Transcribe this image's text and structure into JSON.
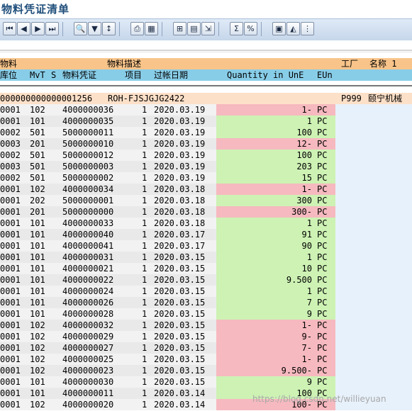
{
  "title": "物料凭证清单",
  "toolbar": {
    "buttons": [
      {
        "name": "first-page",
        "glyph": "⏮"
      },
      {
        "name": "prev",
        "glyph": "◀"
      },
      {
        "name": "next",
        "glyph": "▶"
      },
      {
        "name": "last-page",
        "glyph": "⏭"
      },
      {
        "name": "find",
        "glyph": "🔍"
      },
      {
        "name": "filter",
        "glyph": "▼"
      },
      {
        "name": "sort",
        "glyph": "↕"
      },
      {
        "name": "print",
        "glyph": "⎙"
      },
      {
        "name": "select-layout",
        "glyph": "▦"
      },
      {
        "name": "details",
        "glyph": "⊞"
      },
      {
        "name": "grid",
        "glyph": "▤"
      },
      {
        "name": "export",
        "glyph": "⇲"
      },
      {
        "name": "sum",
        "glyph": "Σ"
      },
      {
        "name": "subtotal",
        "glyph": "%"
      },
      {
        "name": "abc",
        "glyph": "▣"
      },
      {
        "name": "graph",
        "glyph": "◭"
      },
      {
        "name": "views",
        "glyph": "⋮"
      }
    ]
  },
  "header": {
    "row1": {
      "material": "物料",
      "description": "物料描述",
      "plant": "工厂",
      "name": "名称 1"
    },
    "row2": {
      "sloc": "库位",
      "mvt": "MvT",
      "s": "S",
      "doc": "物料凭证",
      "item": "项目",
      "date": "过帐日期",
      "qty": "Quantity in UnE",
      "eun": "EUn"
    }
  },
  "group": {
    "material": "000000000000001256",
    "description": "ROH-FJSJGJG2422",
    "plant": "P999",
    "name": "颐宁机械"
  },
  "rows": [
    {
      "sloc": "0001",
      "mvt": "102",
      "doc": "4000000036",
      "item": "1",
      "date": "2020.03.19",
      "qty": "1-",
      "unit": "PC",
      "neg": true
    },
    {
      "sloc": "0001",
      "mvt": "101",
      "doc": "4000000035",
      "item": "1",
      "date": "2020.03.19",
      "qty": "1",
      "unit": "PC",
      "neg": false
    },
    {
      "sloc": "0002",
      "mvt": "501",
      "doc": "5000000011",
      "item": "1",
      "date": "2020.03.19",
      "qty": "100",
      "unit": "PC",
      "neg": false
    },
    {
      "sloc": "0003",
      "mvt": "201",
      "doc": "5000000010",
      "item": "1",
      "date": "2020.03.19",
      "qty": "12-",
      "unit": "PC",
      "neg": true
    },
    {
      "sloc": "0002",
      "mvt": "501",
      "doc": "5000000012",
      "item": "1",
      "date": "2020.03.19",
      "qty": "100",
      "unit": "PC",
      "neg": false
    },
    {
      "sloc": "0003",
      "mvt": "501",
      "doc": "5000000003",
      "item": "1",
      "date": "2020.03.19",
      "qty": "203",
      "unit": "PC",
      "neg": false
    },
    {
      "sloc": "0002",
      "mvt": "501",
      "doc": "5000000002",
      "item": "1",
      "date": "2020.03.19",
      "qty": "15",
      "unit": "PC",
      "neg": false
    },
    {
      "sloc": "0001",
      "mvt": "102",
      "doc": "4000000034",
      "item": "1",
      "date": "2020.03.18",
      "qty": "1-",
      "unit": "PC",
      "neg": true
    },
    {
      "sloc": "0001",
      "mvt": "202",
      "doc": "5000000001",
      "item": "1",
      "date": "2020.03.18",
      "qty": "300",
      "unit": "PC",
      "neg": false
    },
    {
      "sloc": "0001",
      "mvt": "201",
      "doc": "5000000000",
      "item": "1",
      "date": "2020.03.18",
      "qty": "300-",
      "unit": "PC",
      "neg": true
    },
    {
      "sloc": "0001",
      "mvt": "101",
      "doc": "4000000033",
      "item": "1",
      "date": "2020.03.18",
      "qty": "1",
      "unit": "PC",
      "neg": false
    },
    {
      "sloc": "0001",
      "mvt": "101",
      "doc": "4000000040",
      "item": "1",
      "date": "2020.03.17",
      "qty": "91",
      "unit": "PC",
      "neg": false
    },
    {
      "sloc": "0001",
      "mvt": "101",
      "doc": "4000000041",
      "item": "1",
      "date": "2020.03.17",
      "qty": "90",
      "unit": "PC",
      "neg": false
    },
    {
      "sloc": "0001",
      "mvt": "101",
      "doc": "4000000031",
      "item": "1",
      "date": "2020.03.15",
      "qty": "1",
      "unit": "PC",
      "neg": false
    },
    {
      "sloc": "0001",
      "mvt": "101",
      "doc": "4000000021",
      "item": "1",
      "date": "2020.03.15",
      "qty": "10",
      "unit": "PC",
      "neg": false
    },
    {
      "sloc": "0001",
      "mvt": "101",
      "doc": "4000000022",
      "item": "1",
      "date": "2020.03.15",
      "qty": "9.500",
      "unit": "PC",
      "neg": false
    },
    {
      "sloc": "0001",
      "mvt": "101",
      "doc": "4000000024",
      "item": "1",
      "date": "2020.03.15",
      "qty": "1",
      "unit": "PC",
      "neg": false
    },
    {
      "sloc": "0001",
      "mvt": "101",
      "doc": "4000000026",
      "item": "1",
      "date": "2020.03.15",
      "qty": "7",
      "unit": "PC",
      "neg": false
    },
    {
      "sloc": "0001",
      "mvt": "101",
      "doc": "4000000028",
      "item": "1",
      "date": "2020.03.15",
      "qty": "9",
      "unit": "PC",
      "neg": false
    },
    {
      "sloc": "0001",
      "mvt": "102",
      "doc": "4000000032",
      "item": "1",
      "date": "2020.03.15",
      "qty": "1-",
      "unit": "PC",
      "neg": true
    },
    {
      "sloc": "0001",
      "mvt": "102",
      "doc": "4000000029",
      "item": "1",
      "date": "2020.03.15",
      "qty": "9-",
      "unit": "PC",
      "neg": true
    },
    {
      "sloc": "0001",
      "mvt": "102",
      "doc": "4000000027",
      "item": "1",
      "date": "2020.03.15",
      "qty": "7-",
      "unit": "PC",
      "neg": true
    },
    {
      "sloc": "0001",
      "mvt": "102",
      "doc": "4000000025",
      "item": "1",
      "date": "2020.03.15",
      "qty": "1-",
      "unit": "PC",
      "neg": true
    },
    {
      "sloc": "0001",
      "mvt": "102",
      "doc": "4000000023",
      "item": "1",
      "date": "2020.03.15",
      "qty": "9.500-",
      "unit": "PC",
      "neg": true
    },
    {
      "sloc": "0001",
      "mvt": "101",
      "doc": "4000000030",
      "item": "1",
      "date": "2020.03.15",
      "qty": "9",
      "unit": "PC",
      "neg": false
    },
    {
      "sloc": "0001",
      "mvt": "101",
      "doc": "4000000011",
      "item": "1",
      "date": "2020.03.14",
      "qty": "100",
      "unit": "PC",
      "neg": false
    },
    {
      "sloc": "0001",
      "mvt": "102",
      "doc": "4000000020",
      "item": "1",
      "date": "2020.03.14",
      "qty": "100-",
      "unit": "PC",
      "neg": true
    }
  ],
  "watermark": "https://blog.csdn.net/willieyuan",
  "colors": {
    "header1": "#f8c48a",
    "header2": "#88cde8",
    "group": "#fde0c8",
    "qty_pos": "#cdf2b4",
    "qty_neg": "#f6b9bf"
  }
}
